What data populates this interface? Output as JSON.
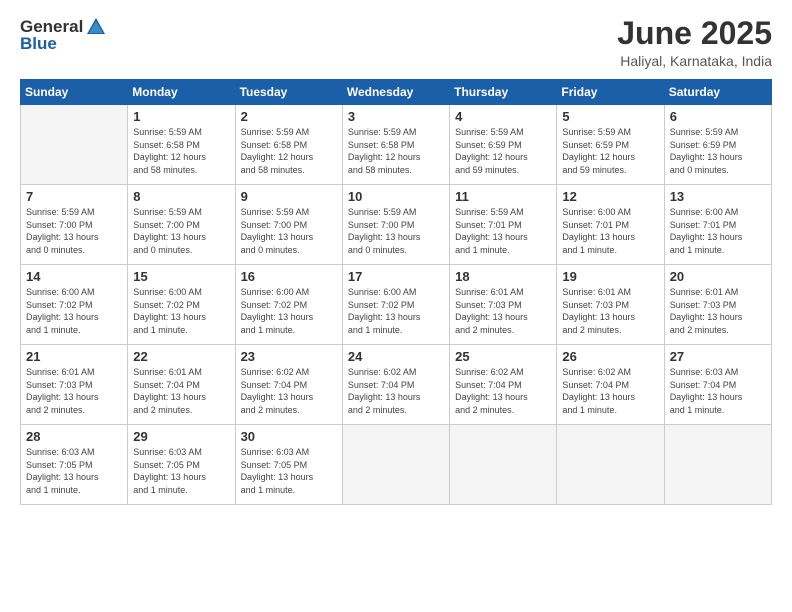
{
  "logo": {
    "general": "General",
    "blue": "Blue"
  },
  "title": "June 2025",
  "subtitle": "Haliyal, Karnataka, India",
  "weekdays": [
    "Sunday",
    "Monday",
    "Tuesday",
    "Wednesday",
    "Thursday",
    "Friday",
    "Saturday"
  ],
  "days": [
    {
      "day": "",
      "info": ""
    },
    {
      "day": "1",
      "info": "Sunrise: 5:59 AM\nSunset: 6:58 PM\nDaylight: 12 hours\nand 58 minutes."
    },
    {
      "day": "2",
      "info": "Sunrise: 5:59 AM\nSunset: 6:58 PM\nDaylight: 12 hours\nand 58 minutes."
    },
    {
      "day": "3",
      "info": "Sunrise: 5:59 AM\nSunset: 6:58 PM\nDaylight: 12 hours\nand 58 minutes."
    },
    {
      "day": "4",
      "info": "Sunrise: 5:59 AM\nSunset: 6:59 PM\nDaylight: 12 hours\nand 59 minutes."
    },
    {
      "day": "5",
      "info": "Sunrise: 5:59 AM\nSunset: 6:59 PM\nDaylight: 12 hours\nand 59 minutes."
    },
    {
      "day": "6",
      "info": "Sunrise: 5:59 AM\nSunset: 6:59 PM\nDaylight: 13 hours\nand 0 minutes."
    },
    {
      "day": "7",
      "info": "Sunrise: 5:59 AM\nSunset: 7:00 PM\nDaylight: 13 hours\nand 0 minutes."
    },
    {
      "day": "8",
      "info": "Sunrise: 5:59 AM\nSunset: 7:00 PM\nDaylight: 13 hours\nand 0 minutes."
    },
    {
      "day": "9",
      "info": "Sunrise: 5:59 AM\nSunset: 7:00 PM\nDaylight: 13 hours\nand 0 minutes."
    },
    {
      "day": "10",
      "info": "Sunrise: 5:59 AM\nSunset: 7:00 PM\nDaylight: 13 hours\nand 0 minutes."
    },
    {
      "day": "11",
      "info": "Sunrise: 5:59 AM\nSunset: 7:01 PM\nDaylight: 13 hours\nand 1 minute."
    },
    {
      "day": "12",
      "info": "Sunrise: 6:00 AM\nSunset: 7:01 PM\nDaylight: 13 hours\nand 1 minute."
    },
    {
      "day": "13",
      "info": "Sunrise: 6:00 AM\nSunset: 7:01 PM\nDaylight: 13 hours\nand 1 minute."
    },
    {
      "day": "14",
      "info": "Sunrise: 6:00 AM\nSunset: 7:02 PM\nDaylight: 13 hours\nand 1 minute."
    },
    {
      "day": "15",
      "info": "Sunrise: 6:00 AM\nSunset: 7:02 PM\nDaylight: 13 hours\nand 1 minute."
    },
    {
      "day": "16",
      "info": "Sunrise: 6:00 AM\nSunset: 7:02 PM\nDaylight: 13 hours\nand 1 minute."
    },
    {
      "day": "17",
      "info": "Sunrise: 6:00 AM\nSunset: 7:02 PM\nDaylight: 13 hours\nand 1 minute."
    },
    {
      "day": "18",
      "info": "Sunrise: 6:01 AM\nSunset: 7:03 PM\nDaylight: 13 hours\nand 2 minutes."
    },
    {
      "day": "19",
      "info": "Sunrise: 6:01 AM\nSunset: 7:03 PM\nDaylight: 13 hours\nand 2 minutes."
    },
    {
      "day": "20",
      "info": "Sunrise: 6:01 AM\nSunset: 7:03 PM\nDaylight: 13 hours\nand 2 minutes."
    },
    {
      "day": "21",
      "info": "Sunrise: 6:01 AM\nSunset: 7:03 PM\nDaylight: 13 hours\nand 2 minutes."
    },
    {
      "day": "22",
      "info": "Sunrise: 6:01 AM\nSunset: 7:04 PM\nDaylight: 13 hours\nand 2 minutes."
    },
    {
      "day": "23",
      "info": "Sunrise: 6:02 AM\nSunset: 7:04 PM\nDaylight: 13 hours\nand 2 minutes."
    },
    {
      "day": "24",
      "info": "Sunrise: 6:02 AM\nSunset: 7:04 PM\nDaylight: 13 hours\nand 2 minutes."
    },
    {
      "day": "25",
      "info": "Sunrise: 6:02 AM\nSunset: 7:04 PM\nDaylight: 13 hours\nand 2 minutes."
    },
    {
      "day": "26",
      "info": "Sunrise: 6:02 AM\nSunset: 7:04 PM\nDaylight: 13 hours\nand 1 minute."
    },
    {
      "day": "27",
      "info": "Sunrise: 6:03 AM\nSunset: 7:04 PM\nDaylight: 13 hours\nand 1 minute."
    },
    {
      "day": "28",
      "info": "Sunrise: 6:03 AM\nSunset: 7:05 PM\nDaylight: 13 hours\nand 1 minute."
    },
    {
      "day": "29",
      "info": "Sunrise: 6:03 AM\nSunset: 7:05 PM\nDaylight: 13 hours\nand 1 minute."
    },
    {
      "day": "30",
      "info": "Sunrise: 6:03 AM\nSunset: 7:05 PM\nDaylight: 13 hours\nand 1 minute."
    },
    {
      "day": "",
      "info": ""
    },
    {
      "day": "",
      "info": ""
    },
    {
      "day": "",
      "info": ""
    },
    {
      "day": "",
      "info": ""
    },
    {
      "day": "",
      "info": ""
    }
  ]
}
